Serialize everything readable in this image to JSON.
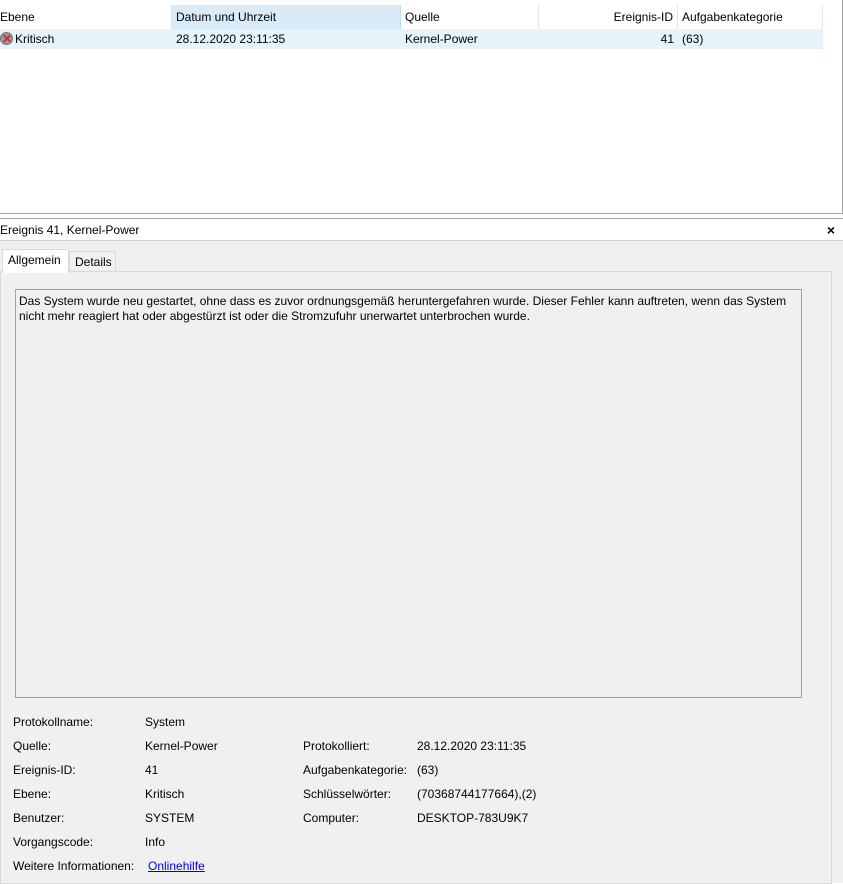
{
  "columns": {
    "level": "Ebene",
    "datetime": "Datum und Uhrzeit",
    "source": "Quelle",
    "event_id": "Ereignis-ID",
    "task_category": "Aufgabenkategorie"
  },
  "events": [
    {
      "level": "Kritisch",
      "level_icon": "critical-icon",
      "datetime": "28.12.2020 23:11:35",
      "source": "Kernel-Power",
      "event_id": "41",
      "task_category": "(63)"
    }
  ],
  "detail": {
    "title": "Ereignis 41, Kernel-Power",
    "close_glyph": "×",
    "tabs": [
      "Allgemein",
      "Details"
    ],
    "description": "Das System wurde neu gestartet, ohne dass es zuvor ordnungsgemäß heruntergefahren wurde. Dieser Fehler kann auftreten, wenn das System nicht mehr reagiert hat oder abgestürzt ist oder die Stromzufuhr unerwartet unterbrochen wurde.",
    "props": {
      "log_name_label": "Protokollname:",
      "log_name": "System",
      "source_label": "Quelle:",
      "source": "Kernel-Power",
      "logged_label": "Protokolliert:",
      "logged": "28.12.2020 23:11:35",
      "event_id_label": "Ereignis-ID:",
      "event_id": "41",
      "task_category_label": "Aufgabenkategorie:",
      "task_category": "(63)",
      "level_label": "Ebene:",
      "level": "Kritisch",
      "keywords_label": "Schlüsselwörter:",
      "keywords": "(70368744177664),(2)",
      "user_label": "Benutzer:",
      "user": "SYSTEM",
      "computer_label": "Computer:",
      "computer": "DESKTOP-783U9K7",
      "opcode_label": "Vorgangscode:",
      "opcode": "Info",
      "more_info_label": "Weitere Informationen:",
      "more_info_link": "Onlinehilfe"
    }
  },
  "colors": {
    "sorted_header": "#d9ebf9",
    "selected_row": "#e5f3fb",
    "pane_background": "#f0f0f0",
    "link": "#0000ee"
  }
}
